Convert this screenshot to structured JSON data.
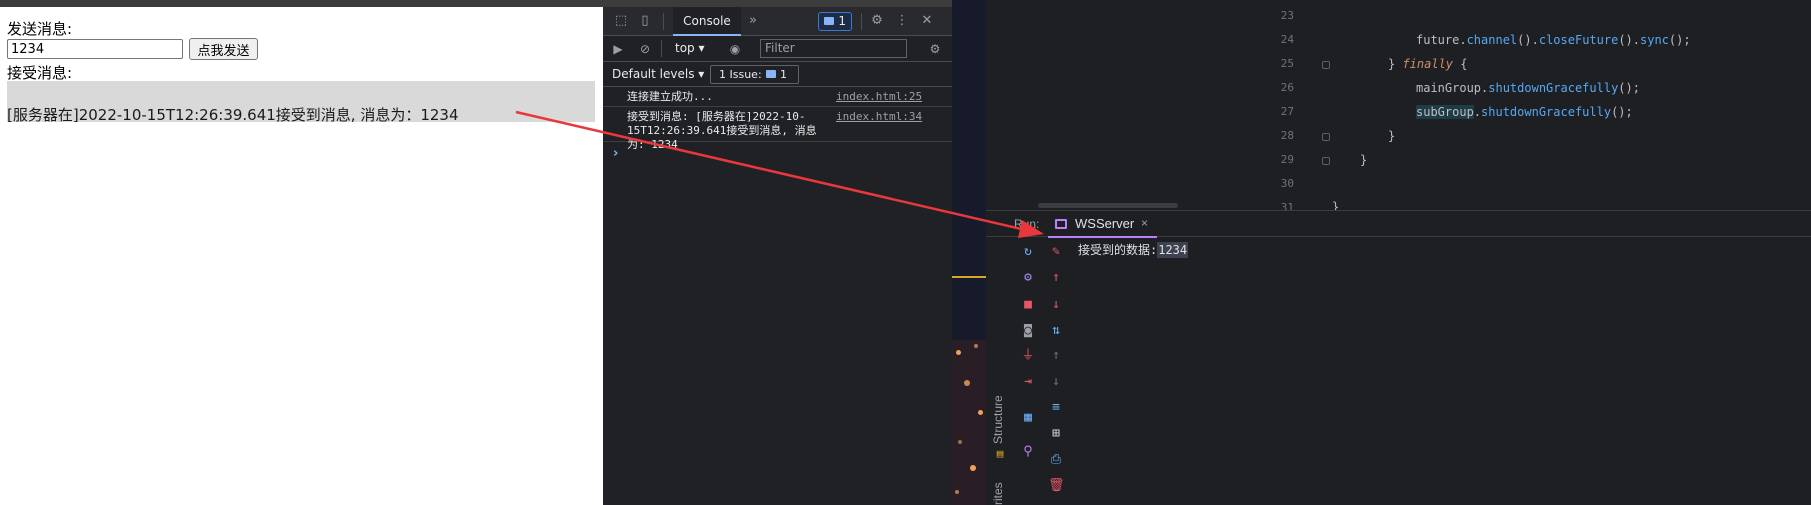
{
  "page": {
    "send_label": "发送消息:",
    "input_value": "1234",
    "send_button": "点我发送",
    "receive_label": "接受消息:",
    "received_message": "[服务器在]2022-10-15T12:26:39.641接受到消息, 消息为：1234"
  },
  "devtools": {
    "tab_console": "Console",
    "more_tabs": "»",
    "message_badge": "1",
    "context": "top",
    "filter_placeholder": "Filter",
    "default_levels": "Default levels",
    "issues_label": "1 Issue:",
    "issues_count": "1",
    "logs": [
      {
        "text": "连接建立成功...",
        "source": "index.html:25"
      },
      {
        "text": "接受到消息: [服务器在]2022-10-15T12:26:39.641接受到消息, 消息为: 1234",
        "source": "index.html:34"
      }
    ],
    "prompt": "›"
  },
  "ide": {
    "line_numbers": [
      "23",
      "24",
      "25",
      "26",
      "27",
      "28",
      "29",
      "30",
      "31"
    ],
    "code": {
      "l24_a": "future.",
      "l24_b": "channel",
      "l24_c": "().",
      "l24_d": "closeFuture",
      "l24_e": "().",
      "l24_f": "sync",
      "l24_g": "();",
      "l25_a": "} ",
      "l25_kw": "finally",
      "l25_b": " {",
      "l26_a": "mainGroup.",
      "l26_b": "shutdownGracefully",
      "l26_c": "();",
      "l27_a": "subGroup",
      "l27_b": ".",
      "l27_c": "shutdownGracefully",
      "l27_d": "();",
      "l28": "}",
      "l29": "}",
      "l31": "}"
    },
    "run_label": "Run:",
    "run_tab": "WSServer",
    "run_tab_close": "×",
    "output_prefix": "接受到的数据:",
    "output_value": "1234",
    "side_structure": "Structure",
    "side_favorites": "rites"
  },
  "colors": {
    "arrow": "#e8383d",
    "keyword": "#cf8e6d",
    "method": "#56a8f5",
    "run_tab_accent": "#bd7ef9",
    "devtools_accent": "#8ab4f8"
  }
}
